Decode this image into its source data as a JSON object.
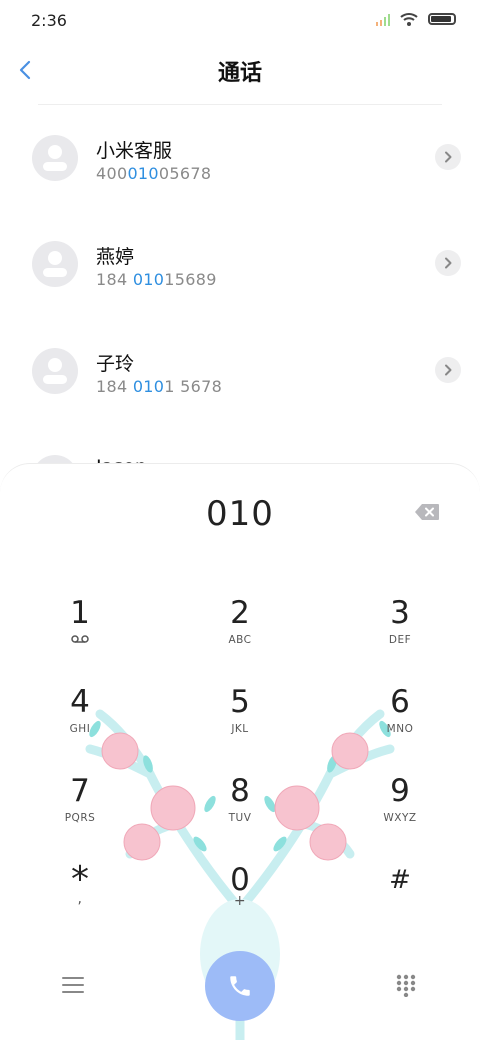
{
  "status_bar": {
    "time": "2:36"
  },
  "header": {
    "title": "通话"
  },
  "contacts": [
    {
      "name": "小米客服",
      "number_pre": "400",
      "number_match": "010",
      "number_post": "05678"
    },
    {
      "name": "燕婷",
      "number_pre": "184 ",
      "number_match": "010",
      "number_post": "15689"
    },
    {
      "name": "子玲",
      "number_pre": "184 ",
      "number_match": "010",
      "number_post": "1 5678"
    },
    {
      "name": "Jason",
      "number_pre": "",
      "number_match": "",
      "number_post": ""
    }
  ],
  "dialer": {
    "input": "010",
    "keys": [
      {
        "digit": "1",
        "letters": "voicemail"
      },
      {
        "digit": "2",
        "letters": "ABC"
      },
      {
        "digit": "3",
        "letters": "DEF"
      },
      {
        "digit": "4",
        "letters": "GHI"
      },
      {
        "digit": "5",
        "letters": "JKL"
      },
      {
        "digit": "6",
        "letters": "MNO"
      },
      {
        "digit": "7",
        "letters": "PQRS"
      },
      {
        "digit": "8",
        "letters": "TUV"
      },
      {
        "digit": "9",
        "letters": "WXYZ"
      },
      {
        "digit": "*",
        "letters": ","
      },
      {
        "digit": "0",
        "letters": "+"
      },
      {
        "digit": "#",
        "letters": ""
      }
    ]
  },
  "colors": {
    "accent": "#2f8fe0",
    "call_button": "#9dbbf7",
    "back_arrow": "#4a90e2"
  },
  "icons": {
    "back": "chevron-left-icon",
    "chevron": "chevron-right-icon",
    "backspace": "backspace-icon",
    "menu": "menu-icon",
    "call": "phone-icon",
    "dialpad": "dialpad-grid-icon",
    "voicemail": "voicemail-icon"
  }
}
